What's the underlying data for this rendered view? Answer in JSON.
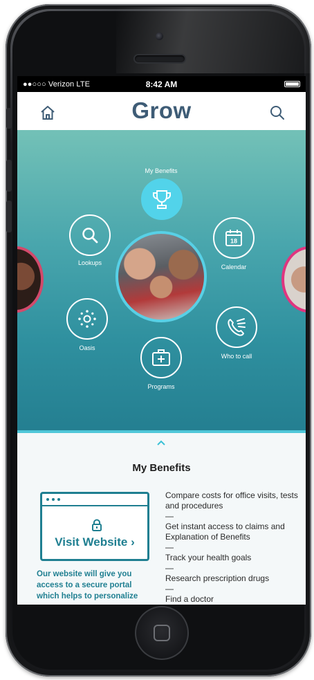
{
  "status_bar": {
    "carrier": "●●○○○ Verizon  LTE",
    "time": "8:42 AM"
  },
  "header": {
    "title": "Grow",
    "home_icon": "home-icon",
    "search_icon": "search-icon"
  },
  "colors": {
    "brand_title": "#3e5c76",
    "accent": "#52d3ea",
    "teal_text": "#1f7f91",
    "hero_top": "#73c1b7",
    "hero_bottom": "#247f91"
  },
  "menu": {
    "items": [
      {
        "label": "My Benefits",
        "icon": "trophy-icon",
        "active": true
      },
      {
        "label": "Calendar",
        "icon": "calendar-icon",
        "calendar_day": "18"
      },
      {
        "label": "Who to call",
        "icon": "phone-icon"
      },
      {
        "label": "Programs",
        "icon": "medical-kit-icon"
      },
      {
        "label": "Oasis",
        "icon": "oasis-icon"
      },
      {
        "label": "Lookups",
        "icon": "search-icon"
      }
    ]
  },
  "panel": {
    "title": "My Benefits",
    "website_button": "Visit Website ›",
    "website_description": "Our website will give you access to a secure portal which helps to personalize",
    "benefits": [
      "Compare costs for office visits, tests and procedures",
      "Get instant access to claims and Explanation of Benefits",
      "Track your health goals",
      "Research prescription drugs",
      "Find a doctor"
    ],
    "separator": "—"
  }
}
